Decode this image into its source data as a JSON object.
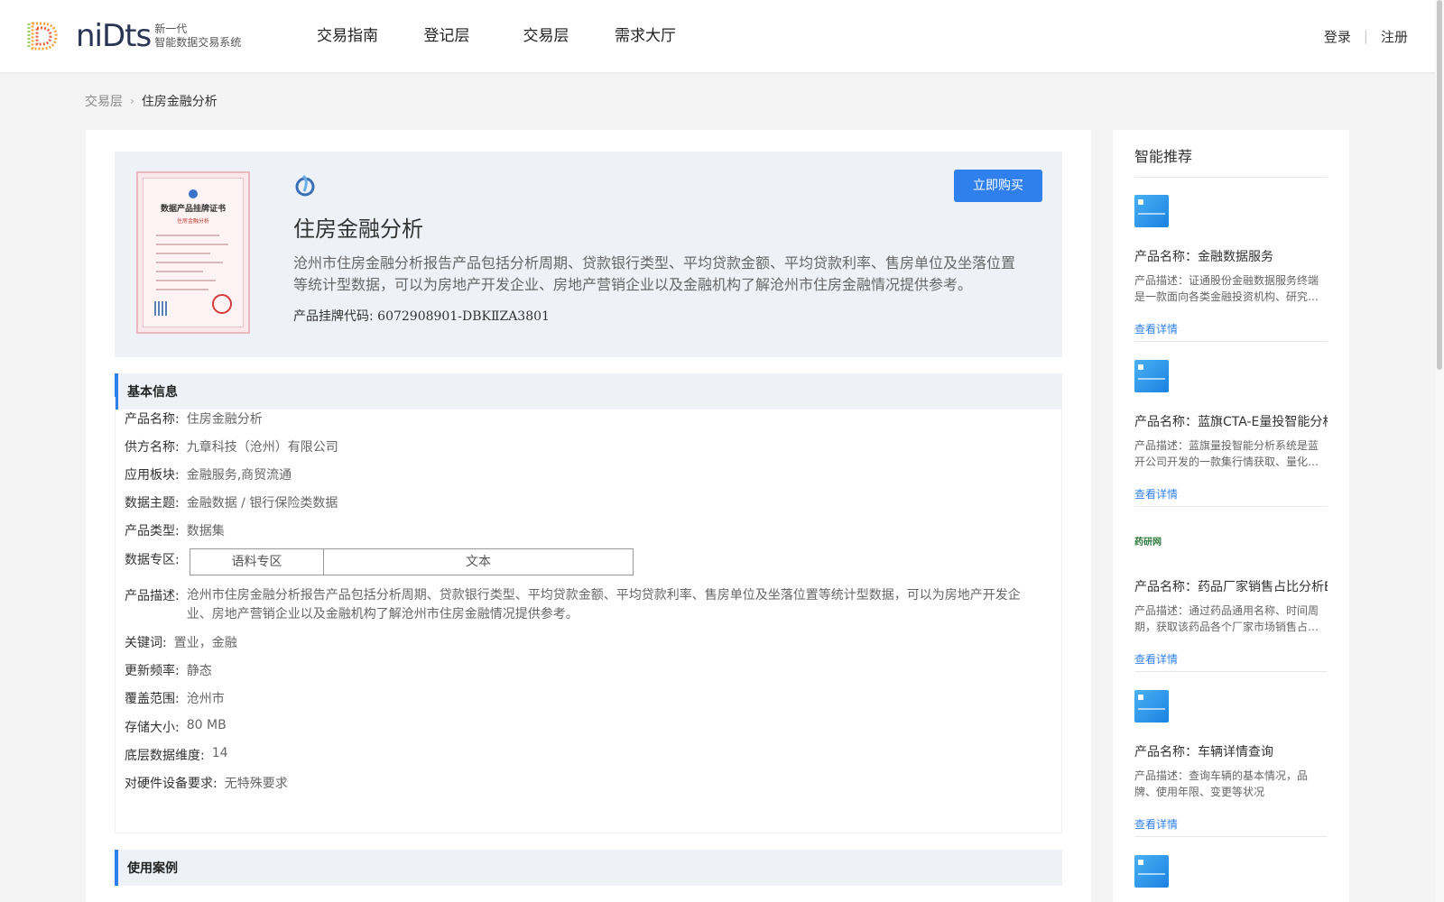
{
  "header": {
    "logo_text": "niDts",
    "logo_sub_line1": "新一代",
    "logo_sub_line2": "智能数据交易系统",
    "nav": [
      {
        "label": "交易指南"
      },
      {
        "label": "登记层"
      },
      {
        "label": "交易层"
      },
      {
        "label": "需求大厅"
      }
    ],
    "login": "登录",
    "register": "注册"
  },
  "breadcrumb": {
    "parent": "交易层",
    "current": "住房金融分析"
  },
  "certificate": {
    "title": "数据产品挂牌证书",
    "subtitle": "住房金融分析"
  },
  "product": {
    "title": "住房金融分析",
    "description": "沧州市住房金融分析报告产品包括分析周期、贷款银行类型、平均贷款金额、平均贷款利率、售房单位及坐落位置等统计型数据，可以为房地产开发企业、房地产营销企业以及金融机构了解沧州市住房金融情况提供参考。",
    "code_label": "产品挂牌代码:",
    "code_value": "6072908901-DBKⅡZA3801",
    "buy_button": "立即购买"
  },
  "basic_info": {
    "section_title": "基本信息",
    "name_label": "产品名称:",
    "name_value": "住房金融分析",
    "supplier_label": "供方名称:",
    "supplier_value": "九章科技（沧州）有限公司",
    "sector_label": "应用板块:",
    "sector_value": "金融服务,商贸流通",
    "topic_label": "数据主题:",
    "topic_value": "金融数据 / 银行保险类数据",
    "type_label": "产品类型:",
    "type_value": "数据集",
    "zone_label": "数据专区:",
    "zone_col1": "语料专区",
    "zone_col2": "文本",
    "desc_label": "产品描述:",
    "desc_value": "沧州市住房金融分析报告产品包括分析周期、贷款银行类型、平均贷款金额、平均贷款利率、售房单位及坐落位置等统计型数据，可以为房地产开发企业、房地产营销企业以及金融机构了解沧州市住房金融情况提供参考。",
    "keywords_label": "关键词:",
    "keywords_value": "置业，金融",
    "freq_label": "更新频率:",
    "freq_value": "静态",
    "coverage_label": "覆盖范围:",
    "coverage_value": "沧州市",
    "size_label": "存储大小:",
    "size_value": "80 MB",
    "dim_label": "底层数据维度:",
    "dim_value": "14",
    "hw_label": "对硬件设备要求:",
    "hw_value": "无特殊要求"
  },
  "use_cases": {
    "section_title": "使用案例"
  },
  "sidebar": {
    "title": "智能推荐",
    "link_label": "查看详情",
    "items": [
      {
        "name": "产品名称：金融数据服务",
        "desc": "产品描述：证通股份金融数据服务终端是一款面向各类金融投资机构、研究…",
        "thumb": "blue"
      },
      {
        "name": "产品名称：蓝旗CTA-E量投智能分析",
        "desc": "产品描述：蓝旗量投智能分析系统是蓝开公司开发的一款集行情获取、量化…",
        "thumb": "blue"
      },
      {
        "name": "产品名称：药品厂家销售占比分析E",
        "desc": "产品描述：通过药品通用名称、时间周期，获取该药品各个厂家市场销售占…",
        "thumb": "brand",
        "brand": "药研网"
      },
      {
        "name": "产品名称：车辆详情查询",
        "desc": "产品描述：查询车辆的基本情况，品牌、使用年限、变更等状况",
        "thumb": "blue"
      }
    ]
  },
  "colors": {
    "accent": "#2f80ed",
    "hero_bg": "#eef2f7",
    "page_bg": "#f4f4f4"
  }
}
